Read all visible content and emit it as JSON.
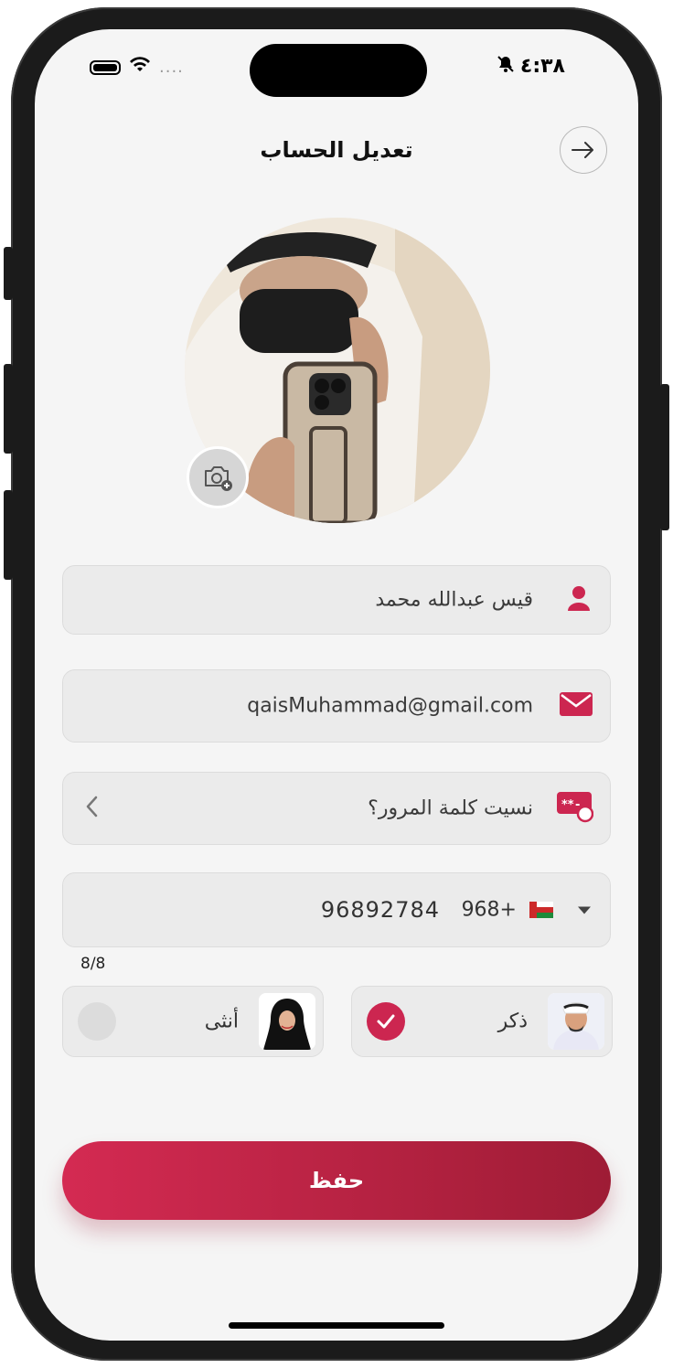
{
  "status_bar": {
    "time": "٤:٣٨",
    "signal_dots": "....",
    "bell": "🔕"
  },
  "header": {
    "title": "تعديل الحساب"
  },
  "form": {
    "name_value": "قيس عبدالله محمد",
    "email_value": "qaisMuhammad@gmail.com",
    "forgot_password_label": "نسيت كلمة المرور؟",
    "phone": {
      "country_flag": "🇴🇲",
      "country_code": "968+",
      "number": "96892784"
    },
    "counter": "8/8"
  },
  "gender": {
    "male_label": "ذكر",
    "female_label": "أنثى",
    "selected": "male"
  },
  "save_label": "حفظ",
  "colors": {
    "accent": "#cc2650",
    "field_bg": "#ebebeb",
    "page_bg": "#f5f5f5"
  },
  "icons": {
    "back": "arrow-right-icon",
    "camera": "camera-plus-icon",
    "user": "user-icon",
    "email": "envelope-icon",
    "password": "password-reset-icon",
    "chevron": "chevron-left-icon",
    "dropdown": "caret-down-icon",
    "check": "check-icon"
  }
}
